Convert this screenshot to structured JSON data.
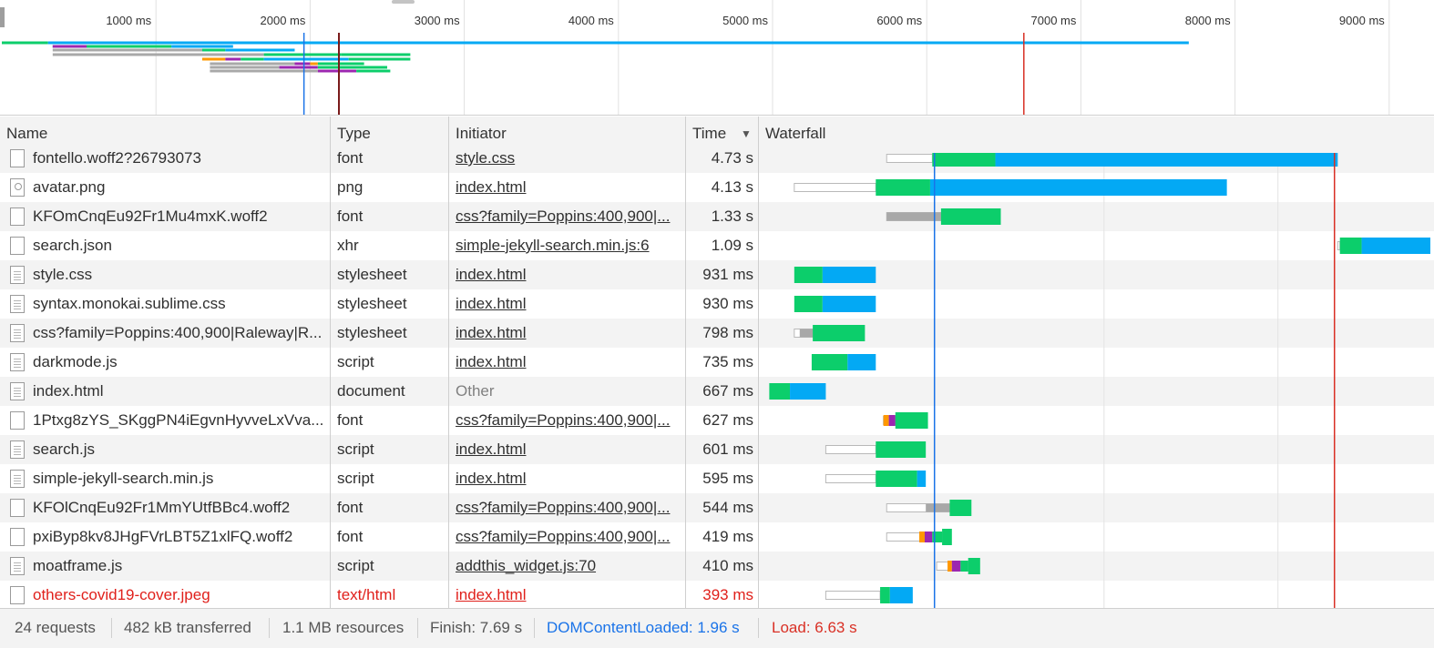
{
  "overview": {
    "tick_labels": [
      "1000 ms",
      "2000 ms",
      "3000 ms",
      "4000 ms",
      "5000 ms",
      "6000 ms",
      "7000 ms",
      "8000 ms",
      "9000 ms"
    ],
    "dcl_ms": 1960,
    "load_ms": 6630
  },
  "columns": {
    "name": "Name",
    "type": "Type",
    "initiator": "Initiator",
    "time": "Time",
    "sort_arrow": "▼",
    "waterfall": "Waterfall"
  },
  "requests": [
    {
      "name": "fontello.woff2?26793073",
      "type": "font",
      "initiator": "style.css",
      "time": "4.73 s",
      "icon": "file",
      "error": false
    },
    {
      "name": "avatar.png",
      "type": "png",
      "initiator": "index.html",
      "time": "4.13 s",
      "icon": "image",
      "error": false
    },
    {
      "name": "KFOmCnqEu92Fr1Mu4mxK.woff2",
      "type": "font",
      "initiator": "css?family=Poppins:400,900|...",
      "time": "1.33 s",
      "icon": "file",
      "error": false
    },
    {
      "name": "search.json",
      "type": "xhr",
      "initiator": "simple-jekyll-search.min.js:6",
      "time": "1.09 s",
      "icon": "file",
      "error": false
    },
    {
      "name": "style.css",
      "type": "stylesheet",
      "initiator": "index.html",
      "time": "931 ms",
      "icon": "doc",
      "error": false
    },
    {
      "name": "syntax.monokai.sublime.css",
      "type": "stylesheet",
      "initiator": "index.html",
      "time": "930 ms",
      "icon": "doc",
      "error": false
    },
    {
      "name": "css?family=Poppins:400,900|Raleway|R...",
      "type": "stylesheet",
      "initiator": "index.html",
      "time": "798 ms",
      "icon": "doc",
      "error": false
    },
    {
      "name": "darkmode.js",
      "type": "script",
      "initiator": "index.html",
      "time": "735 ms",
      "icon": "doc",
      "error": false
    },
    {
      "name": "index.html",
      "type": "document",
      "initiator": "Other",
      "time": "667 ms",
      "icon": "doc",
      "error": false
    },
    {
      "name": "1Ptxg8zYS_SKggPN4iEgvnHyvveLxVva...",
      "type": "font",
      "initiator": "css?family=Poppins:400,900|...",
      "time": "627 ms",
      "icon": "file",
      "error": false
    },
    {
      "name": "search.js",
      "type": "script",
      "initiator": "index.html",
      "time": "601 ms",
      "icon": "doc",
      "error": false
    },
    {
      "name": "simple-jekyll-search.min.js",
      "type": "script",
      "initiator": "index.html",
      "time": "595 ms",
      "icon": "doc",
      "error": false
    },
    {
      "name": "KFOlCnqEu92Fr1MmYUtfBBc4.woff2",
      "type": "font",
      "initiator": "css?family=Poppins:400,900|...",
      "time": "544 ms",
      "icon": "file",
      "error": false
    },
    {
      "name": "pxiByp8kv8JHgFVrLBT5Z1xlFQ.woff2",
      "type": "font",
      "initiator": "css?family=Poppins:400,900|...",
      "time": "419 ms",
      "icon": "file",
      "error": false
    },
    {
      "name": "moatframe.js",
      "type": "script",
      "initiator": "addthis_widget.js:70",
      "time": "410 ms",
      "icon": "doc",
      "error": false
    },
    {
      "name": "others-covid19-cover.jpeg",
      "type": "text/html",
      "initiator": "index.html",
      "time": "393 ms",
      "icon": "file",
      "error": true
    }
  ],
  "colors": {
    "waiting": "#0cce6b",
    "download": "#03a9f4",
    "queued": "#a8a8a8",
    "ssl": "#9c27b0",
    "connect": "#ff9800",
    "dcl_line": "#1a73e8",
    "load_line": "#d93025"
  },
  "status_bar": {
    "requests": "24 requests",
    "transferred": "482 kB transferred",
    "resources": "1.1 MB resources",
    "finish": "Finish: 7.69 s",
    "dom_content_loaded": "DOMContentLoaded: 1.96 s",
    "load": "Load: 6.63 s"
  }
}
